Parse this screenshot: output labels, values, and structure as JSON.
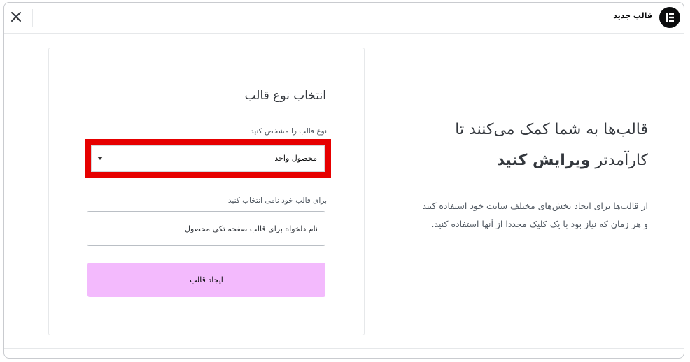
{
  "header": {
    "title": "قالب جدید",
    "close_icon": "close-icon",
    "logo_icon": "elementor-logo-icon"
  },
  "intro": {
    "heading_line1": "قالب‌ها به شما کمک می‌کنند تا",
    "heading_line2_plain": "کارآمدتر",
    "heading_line2_bold": "ویرایش کنید",
    "text": "از قالب‌ها برای ایجاد بخش‌های مختلف سایت خود استفاده کنید و هر زمان که نیاز بود با یک کلیک مجددا از آنها استفاده کنید."
  },
  "form": {
    "title": "انتخاب نوع قالب",
    "type_label": "نوع قالب را مشخص کنید",
    "type_selected": "محصول واحد",
    "name_label": "برای قالب خود نامی انتخاب کنید",
    "name_value": "نام دلخواه برای قالب صفحه تکی محصول",
    "submit_label": "ایجاد قالب"
  },
  "colors": {
    "highlight": "#e60000",
    "button_bg": "#f3bafd",
    "logo_bg": "#0c0d0e"
  }
}
